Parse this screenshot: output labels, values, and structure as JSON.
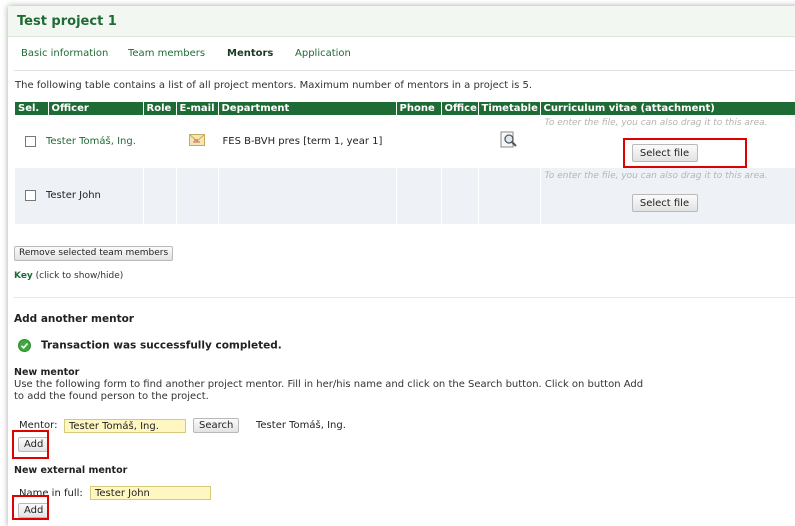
{
  "project": {
    "title": "Test project 1"
  },
  "tabs": [
    {
      "label": "Basic information"
    },
    {
      "label": "Team members"
    },
    {
      "label": "Mentors"
    },
    {
      "label": "Application"
    }
  ],
  "intro": "The following table contains a list of all project mentors. Maximum number of mentors in a project is 5.",
  "table": {
    "headers": [
      "Sel.",
      "Officer",
      "Role",
      "E-mail",
      "Department",
      "Phone",
      "Office",
      "Timetable",
      "Curriculum vitae (attachment)"
    ],
    "rows": [
      {
        "officer": "Tester Tomáš, Ing.",
        "department": "FES B-BVH pres [term 1, year 1]",
        "cv_hint": "To enter the file, you can also drag it to this area.",
        "cv_button": "Select file"
      },
      {
        "officer": "Tester John",
        "department": "",
        "cv_hint": "To enter the file, you can also drag it to this area.",
        "cv_button": "Select file"
      }
    ]
  },
  "remove_button": "Remove selected team members",
  "key": {
    "label": "Key",
    "hint": "(click to show/hide)"
  },
  "add_section": {
    "heading": "Add another mentor",
    "success": "Transaction was successfully completed.",
    "new_mentor": {
      "heading": "New mentor",
      "description": "Use the following form to find another project mentor. Fill in her/his name and click on the Search button. Click on button Add to add the found person to the project.",
      "field_label": "Mentor:",
      "field_value": "Tester Tomáš, Ing.",
      "search_button": "Search",
      "found": "Tester Tomáš, Ing.",
      "add_button": "Add"
    },
    "new_external": {
      "heading": "New external mentor",
      "field_label": "Name in full:",
      "field_value": "Tester John",
      "add_button": "Add"
    }
  },
  "colors": {
    "accent": "#1f6b35",
    "highlight": "#e00000",
    "input_bg": "#fff7c2"
  },
  "icons": {
    "email": "envelope-icon",
    "timetable": "magnifier-document-icon",
    "success": "check-circle-icon"
  }
}
